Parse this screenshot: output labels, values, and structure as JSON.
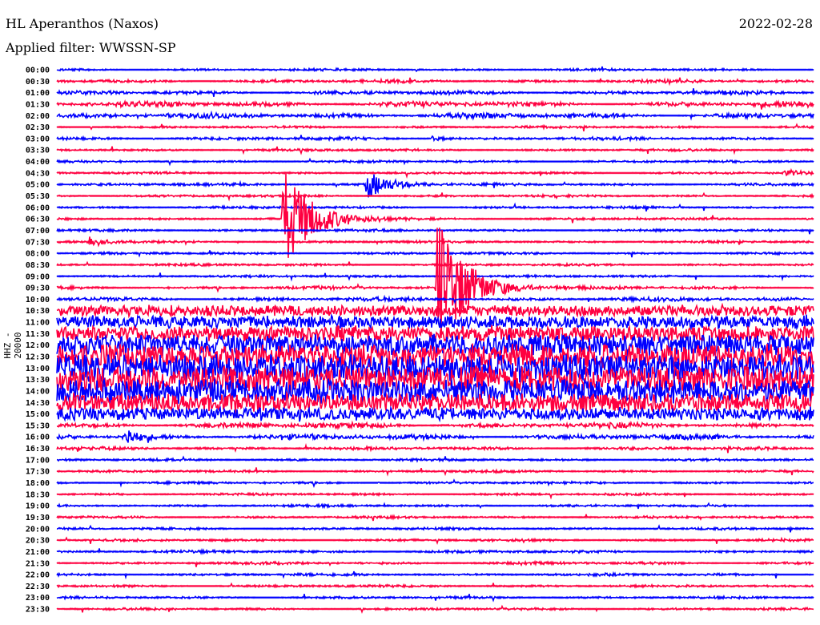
{
  "header": {
    "title": "HL Aperanthos (Naxos)",
    "filter": "Applied filter: WWSSN-SP",
    "date": "2022-02-28",
    "channel": "HHZ - 20000"
  },
  "chart_data": {
    "type": "line",
    "title": "HL Aperanthos (Naxos)",
    "ylabel": "HHZ - 20000",
    "minutes_per_line": 30,
    "colors": {
      "even": "#0000ff",
      "odd": "#ff0040"
    },
    "rows": [
      {
        "label": "00:00",
        "noise": 1
      },
      {
        "label": "00:30",
        "noise": 1.5
      },
      {
        "label": "01:00",
        "noise": 2
      },
      {
        "label": "01:30",
        "noise": 3
      },
      {
        "label": "02:00",
        "noise": 3
      },
      {
        "label": "02:30",
        "noise": 1
      },
      {
        "label": "03:00",
        "noise": 1.5
      },
      {
        "label": "03:30",
        "noise": 1
      },
      {
        "label": "04:00",
        "noise": 1
      },
      {
        "label": "04:30",
        "noise": 1
      },
      {
        "label": "05:00",
        "noise": 1.2
      },
      {
        "label": "05:30",
        "noise": 1
      },
      {
        "label": "06:00",
        "noise": 1
      },
      {
        "label": "06:30",
        "noise": 1
      },
      {
        "label": "07:00",
        "noise": 1
      },
      {
        "label": "07:30",
        "noise": 1
      },
      {
        "label": "08:00",
        "noise": 1
      },
      {
        "label": "08:30",
        "noise": 1
      },
      {
        "label": "09:00",
        "noise": 1
      },
      {
        "label": "09:30",
        "noise": 1.5
      },
      {
        "label": "10:00",
        "noise": 2
      },
      {
        "label": "10:30",
        "noise": 7
      },
      {
        "label": "11:00",
        "noise": 8
      },
      {
        "label": "11:30",
        "noise": 10
      },
      {
        "label": "12:00",
        "noise": 14
      },
      {
        "label": "12:30",
        "noise": 16
      },
      {
        "label": "13:00",
        "noise": 18
      },
      {
        "label": "13:30",
        "noise": 18
      },
      {
        "label": "14:00",
        "noise": 16
      },
      {
        "label": "14:30",
        "noise": 12
      },
      {
        "label": "15:00",
        "noise": 8
      },
      {
        "label": "15:30",
        "noise": 3
      },
      {
        "label": "16:00",
        "noise": 3
      },
      {
        "label": "16:30",
        "noise": 1.5
      },
      {
        "label": "17:00",
        "noise": 1
      },
      {
        "label": "17:30",
        "noise": 1
      },
      {
        "label": "18:00",
        "noise": 1
      },
      {
        "label": "18:30",
        "noise": 1
      },
      {
        "label": "19:00",
        "noise": 1
      },
      {
        "label": "19:30",
        "noise": 1
      },
      {
        "label": "20:00",
        "noise": 1
      },
      {
        "label": "20:30",
        "noise": 1
      },
      {
        "label": "21:00",
        "noise": 1.2
      },
      {
        "label": "21:30",
        "noise": 1.2
      },
      {
        "label": "22:00",
        "noise": 1.2
      },
      {
        "label": "22:30",
        "noise": 1
      },
      {
        "label": "23:00",
        "noise": 1
      },
      {
        "label": "23:30",
        "noise": 1
      }
    ],
    "events": [
      {
        "row": 6,
        "minute": 14.8,
        "amp": 4,
        "dur": 1
      },
      {
        "row": 9,
        "minute": 28.8,
        "amp": 5,
        "dur": 1.2
      },
      {
        "row": 10,
        "minute": 12.2,
        "amp": 20,
        "dur": 2.5
      },
      {
        "row": 13,
        "minute": 8.9,
        "amp": 70,
        "dur": 3
      },
      {
        "row": 15,
        "minute": 1.2,
        "amp": 8,
        "dur": 1.5
      },
      {
        "row": 19,
        "minute": 15.0,
        "amp": 100,
        "dur": 3
      },
      {
        "row": 32,
        "minute": 2.6,
        "amp": 22,
        "dur": 1
      }
    ]
  }
}
